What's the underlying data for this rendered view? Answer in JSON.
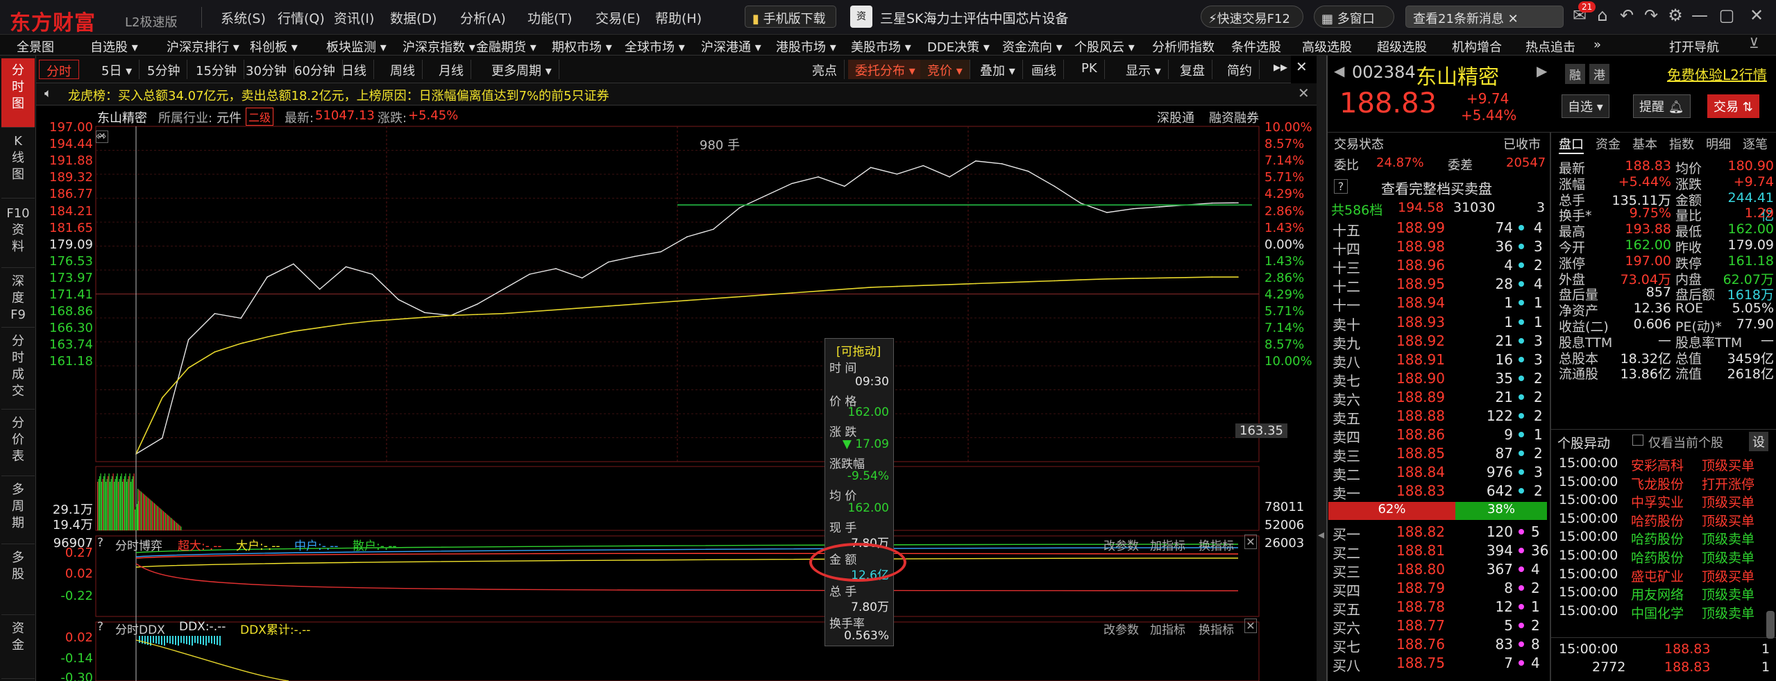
{
  "app": {
    "logo": "东方财富",
    "edition": "L2极速版"
  },
  "top_menu": [
    "系统(S)",
    "行情(Q)",
    "资讯(I)",
    "数据(D)",
    "分析(A)",
    "功能(T)",
    "交易(E)",
    "帮助(H)"
  ],
  "top_pills": {
    "mobile_download": "手机版下载",
    "news_headline": "三星SK海力士评估中国芯片设备",
    "quick_trade": "快速交易F12",
    "multi_window": "多窗口",
    "new_messages": "查看21条新消息",
    "badge": "21"
  },
  "nav": [
    "全景图",
    "自选股 ▾",
    "沪深京排行 ▾",
    "科创板 ▾",
    "板块监测 ▾",
    "沪深京指数 ▾",
    "金融期货 ▾",
    "期权市场 ▾",
    "全球市场 ▾",
    "沪深港通 ▾",
    "港股市场 ▾",
    "美股市场 ▾",
    "DDE决策 ▾",
    "资金流向 ▾",
    "个股风云 ▾",
    "分析师指数",
    "条件选股",
    "高级选股",
    "超级选股",
    "机构增合",
    "热点追击",
    "»"
  ],
  "nav_right": "打开导航",
  "left_tabs": [
    "分\n时\n图",
    "K\n线\n图",
    "F10\n资\n料",
    "深\n度\nF9",
    "分\n时\n成\n交",
    "分\n价\n表",
    "多\n周\n期",
    "多\n股",
    "资\n金"
  ],
  "chart_toolbar": {
    "tabs": [
      "分时",
      "5日 ▾",
      "5分钟",
      "15分钟",
      "30分钟",
      "60分钟",
      "日线",
      "周线",
      "月线",
      "更多周期 ▾"
    ],
    "right": [
      "亮点",
      "委托分布 ▾",
      "竞价 ▾",
      "叠加 ▾",
      "画线",
      "PK",
      "显示 ▾",
      "复盘",
      "简约"
    ]
  },
  "banner": "龙虎榜：买入总额34.07亿元，卖出总额18.2亿元，上榜原因：日涨幅偏离值达到7%的前5只证券",
  "chart_header": {
    "name": "东山精密",
    "industry_label": "所属行业:",
    "industry": "元件",
    "level": "二级",
    "latest_label": "最新:",
    "latest": "51047.13",
    "change_label": "涨跌:",
    "change": "+5.45%",
    "links": [
      "深股通",
      "融资融券"
    ]
  },
  "price_axis": [
    "197.00",
    "194.44",
    "191.88",
    "189.32",
    "186.77",
    "184.21",
    "181.65",
    "179.09",
    "176.53",
    "173.97",
    "171.41",
    "168.86",
    "166.30",
    "163.74",
    "161.18"
  ],
  "pct_axis": [
    "10.00%",
    "8.57%",
    "7.14%",
    "5.71%",
    "4.29%",
    "2.86%",
    "1.43%",
    "0.00%",
    "1.43%",
    "2.86%",
    "4.29%",
    "5.71%",
    "7.14%",
    "8.57%",
    "10.00%"
  ],
  "current_price_tag": "163.35",
  "max_volume_label": "980 手",
  "vol_axis_left": [
    "29.1万",
    "19.4万",
    "96907"
  ],
  "vol_axis_right": [
    "78011",
    "52006",
    "26003"
  ],
  "subpanel1": {
    "title": "分时博弈",
    "labels": [
      "超大:-.--",
      "大户:-.--",
      "中户:-.--",
      "散户:-.--"
    ],
    "axis": [
      "0.27",
      "0.02",
      "-0.22"
    ],
    "actions": [
      "改参数",
      "加指标",
      "换指标"
    ]
  },
  "subpanel2": {
    "title": "分时DDX",
    "labels": [
      "DDX:-.--",
      "DDX累计:-.--"
    ],
    "axis": [
      "0.02",
      "-0.14",
      "-0.30"
    ],
    "actions": [
      "改参数",
      "加指标",
      "换指标"
    ]
  },
  "tooltip": {
    "drag": "[可拖动]",
    "time_label": "时 间",
    "time": "09:30",
    "price_label": "价 格",
    "price": "162.00",
    "change_label": "涨 跌",
    "change": "▼ 17.09",
    "pct_label": "涨跌幅",
    "pct": "-9.54%",
    "avg_label": "均 价",
    "avg": "162.00",
    "now_vol_label": "现 手",
    "now_vol": "7.80万",
    "amount_label": "金 额",
    "amount": "12.6亿",
    "total_label": "总 手",
    "total": "7.80万",
    "turnover_label": "换手率",
    "turnover": "0.563%"
  },
  "chart_data": {
    "type": "line",
    "title": "",
    "xlabel": "",
    "ylabel": "",
    "ylim": [
      161.18,
      197.0
    ],
    "prev_close": 179.09,
    "series": [
      {
        "values": [
          162.0,
          163.7,
          174.2,
          177.0,
          176.5,
          180.9,
          182.3,
          179.6,
          182.0,
          181.2,
          178.5,
          177.1,
          176.8,
          178.0,
          179.6,
          181.2,
          181.8,
          180.8,
          182.5,
          183.1,
          183.6,
          185.2,
          186.0,
          188.3,
          189.6,
          190.9,
          191.6,
          190.6,
          192.6,
          191.9,
          192.8,
          191.6,
          193.3,
          193.0,
          192.2,
          190.6,
          188.8,
          187.8,
          188.2,
          188.4,
          188.6,
          188.8,
          188.83
        ]
      },
      {
        "values": [
          162.0,
          168.0,
          171.2,
          172.9,
          173.8,
          174.5,
          175.1,
          175.5,
          175.9,
          176.2,
          176.4,
          176.6,
          176.8,
          176.9,
          177.0,
          177.2,
          177.4,
          177.6,
          177.8,
          178.0,
          178.2,
          178.4,
          178.6,
          178.8,
          179.0,
          179.2,
          179.4,
          179.6,
          179.8,
          179.9,
          180.0,
          180.1,
          180.2,
          180.3,
          180.4,
          180.5,
          180.6,
          180.7,
          180.75,
          180.8,
          180.85,
          180.9,
          180.9
        ]
      }
    ]
  },
  "quote": {
    "code": "002384",
    "name": "东山精密",
    "price": "188.83",
    "change": "+9.74",
    "pct": "+5.44%",
    "tabs_top": [
      "融",
      "港"
    ],
    "l2_link": "免费体验L2行情",
    "btn_watch": "自选",
    "btn_alert": "提醒",
    "btn_trade": "交易"
  },
  "trade_status": {
    "label": "交易状态",
    "value": "已收市"
  },
  "commission": {
    "ratio_label": "委比",
    "ratio": "24.87%",
    "diff_label": "委差",
    "diff": "20547"
  },
  "full_book": "查看完整档买卖盘",
  "book_total": {
    "label": "共586档",
    "price": "194.58",
    "vol": "31030",
    "n": "3"
  },
  "asks": [
    {
      "label": "十五",
      "price": "188.99",
      "vol": "74",
      "n": "4"
    },
    {
      "label": "十四",
      "price": "188.98",
      "vol": "36",
      "n": "3"
    },
    {
      "label": "十三",
      "price": "188.96",
      "vol": "4",
      "n": "2"
    },
    {
      "label": "十二",
      "price": "188.95",
      "vol": "28",
      "n": "4"
    },
    {
      "label": "十一",
      "price": "188.94",
      "vol": "1",
      "n": "1"
    },
    {
      "label": "卖十",
      "price": "188.93",
      "vol": "1",
      "n": "1"
    },
    {
      "label": "卖九",
      "price": "188.92",
      "vol": "21",
      "n": "3"
    },
    {
      "label": "卖八",
      "price": "188.91",
      "vol": "16",
      "n": "3"
    },
    {
      "label": "卖七",
      "price": "188.90",
      "vol": "35",
      "n": "2"
    },
    {
      "label": "卖六",
      "price": "188.89",
      "vol": "21",
      "n": "2"
    },
    {
      "label": "卖五",
      "price": "188.88",
      "vol": "122",
      "n": "2"
    },
    {
      "label": "卖四",
      "price": "188.86",
      "vol": "9",
      "n": "1"
    },
    {
      "label": "卖三",
      "price": "188.85",
      "vol": "87",
      "n": "2"
    },
    {
      "label": "卖二",
      "price": "188.84",
      "vol": "976",
      "n": "3"
    },
    {
      "label": "卖一",
      "price": "188.83",
      "vol": "642",
      "n": "2"
    }
  ],
  "book_bar": {
    "left": "62%",
    "right": "38%"
  },
  "bids": [
    {
      "label": "买一",
      "price": "188.82",
      "vol": "120",
      "n": "5"
    },
    {
      "label": "买二",
      "price": "188.81",
      "vol": "394",
      "n": "36"
    },
    {
      "label": "买三",
      "price": "188.80",
      "vol": "367",
      "n": "4"
    },
    {
      "label": "买四",
      "price": "188.79",
      "vol": "8",
      "n": "2"
    },
    {
      "label": "买五",
      "price": "188.78",
      "vol": "12",
      "n": "1"
    },
    {
      "label": "买六",
      "price": "188.77",
      "vol": "5",
      "n": "2"
    },
    {
      "label": "买七",
      "price": "188.76",
      "vol": "83",
      "n": "8"
    },
    {
      "label": "买八",
      "price": "188.75",
      "vol": "7",
      "n": "4"
    }
  ],
  "stat_tabs": [
    "盘口",
    "资金",
    "基本",
    "指数",
    "明细",
    "逐笔"
  ],
  "stats": [
    [
      "最新",
      "188.83",
      "均价",
      "180.90"
    ],
    [
      "涨幅",
      "+5.44%",
      "涨跌",
      "+9.74"
    ],
    [
      "总手",
      "135.11万",
      "金额",
      "244.41亿"
    ],
    [
      "换手*",
      "9.75%",
      "量比",
      "1.29"
    ],
    [
      "最高",
      "193.88",
      "最低",
      "162.00"
    ],
    [
      "今开",
      "162.00",
      "昨收",
      "179.09"
    ],
    [
      "涨停",
      "197.00",
      "跌停",
      "161.18"
    ],
    [
      "外盘",
      "73.04万",
      "内盘",
      "62.07万"
    ],
    [
      "盘后量",
      "857",
      "盘后额",
      "1618万"
    ],
    [
      "净资产",
      "12.36",
      "ROE",
      "5.05%"
    ],
    [
      "收益(二)",
      "0.606",
      "PE(动)*",
      "77.90"
    ],
    [
      "股息TTM",
      "—",
      "股息率TTM",
      "—"
    ],
    [
      "总股本",
      "18.32亿",
      "总值",
      "3459亿"
    ],
    [
      "流通股",
      "13.86亿",
      "流值",
      "2618亿"
    ]
  ],
  "movers": {
    "title": "个股异动",
    "checkbox": "仅看当前个股",
    "settings": "设",
    "rows": [
      [
        "15:00:00",
        "安彩高科",
        "顶级买单"
      ],
      [
        "15:00:00",
        "飞龙股份",
        "打开涨停"
      ],
      [
        "15:00:00",
        "中孚实业",
        "顶级买单"
      ],
      [
        "15:00:00",
        "哈药股份",
        "顶级买单"
      ],
      [
        "15:00:00",
        "哈药股份",
        "顶级卖单"
      ],
      [
        "15:00:00",
        "哈药股份",
        "顶级卖单"
      ],
      [
        "15:00:00",
        "盛屯矿业",
        "顶级买单"
      ],
      [
        "15:00:00",
        "用友网络",
        "顶级卖单"
      ],
      [
        "15:00:00",
        "中国化学",
        "顶级卖单"
      ]
    ]
  },
  "last_trade": {
    "time": "15:00:00",
    "price": "188.83",
    "n": "1",
    "vol": "2772",
    "price2": "188.83",
    "n2": "1"
  }
}
